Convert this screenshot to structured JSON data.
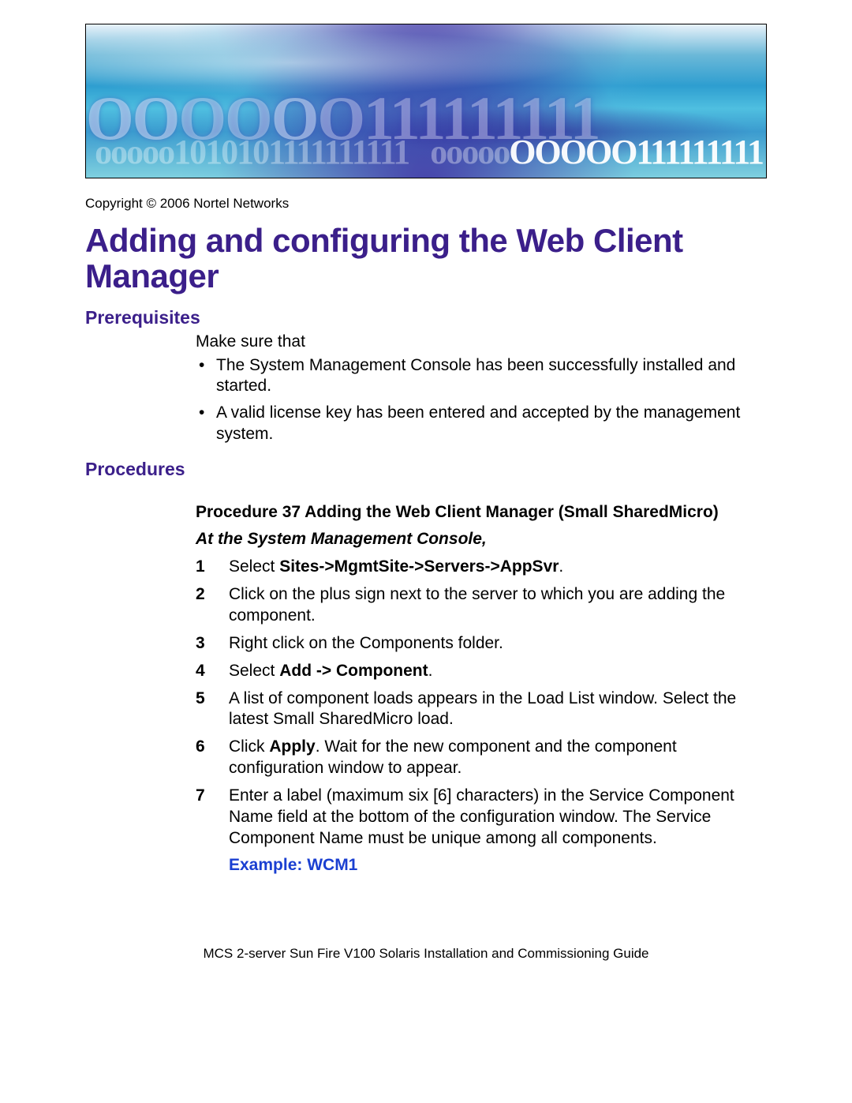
{
  "copyright": "Copyright © 2006 Nortel Networks",
  "title": "Adding and configuring the Web Client Manager",
  "sections": {
    "prereq_heading": "Prerequisites",
    "prereq_intro": "Make sure that",
    "prereq_items": [
      "The System Management Console has been successfully installed and started.",
      "A valid license key has been entered and accepted by the management system."
    ],
    "proc_heading": "Procedures",
    "procedure": {
      "title": "Procedure 37  Adding the Web Client Manager (Small SharedMicro)",
      "context": "At the System Management Console,",
      "steps": [
        {
          "prefix": "Select ",
          "bold": "Sites->MgmtSite->Servers->AppSvr",
          "suffix": "."
        },
        {
          "plain": "Click on the plus sign next to the server to which you are adding the component."
        },
        {
          "plain": "Right click on the Components folder."
        },
        {
          "prefix": "Select ",
          "bold": "Add -> Component",
          "suffix": "."
        },
        {
          "plain": "A list of component loads appears in the Load List window. Select the latest Small SharedMicro load."
        },
        {
          "prefix": "Click ",
          "bold": "Apply",
          "suffix": ". Wait for the new component and the component configuration window to appear."
        },
        {
          "plain": "Enter a label (maximum six [6] characters) in the Service Component Name field at the bottom of the configuration window. The Service Component Name must be unique among all components."
        }
      ],
      "example": "Example: WCM1"
    }
  },
  "footer": "MCS 2-server Sun Fire V100 Solaris Installation and Commissioning Guide"
}
